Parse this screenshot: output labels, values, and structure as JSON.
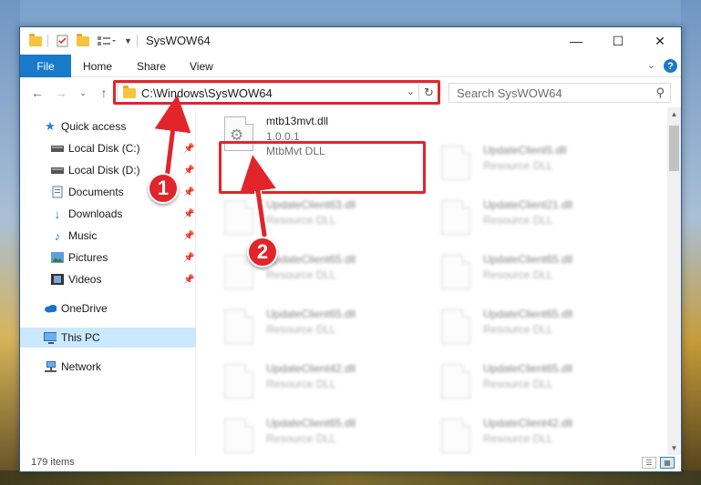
{
  "window": {
    "title": "SysWOW64",
    "controls": {
      "minimize": "—",
      "maximize": "☐",
      "close": "✕"
    }
  },
  "ribbon": {
    "tabs": [
      "File",
      "Home",
      "Share",
      "View"
    ],
    "help": "?"
  },
  "navbar": {
    "address": "C:\\Windows\\SysWOW64",
    "search_placeholder": "Search SysWOW64"
  },
  "sidebar": {
    "items": [
      {
        "label": "Quick access",
        "icon": "star-icon",
        "pinned": false
      },
      {
        "label": "Local Disk (C:)",
        "icon": "drive-icon",
        "pinned": true
      },
      {
        "label": "Local Disk (D:)",
        "icon": "drive-icon",
        "pinned": true
      },
      {
        "label": "Documents",
        "icon": "documents-icon",
        "pinned": true
      },
      {
        "label": "Downloads",
        "icon": "download-icon",
        "pinned": true
      },
      {
        "label": "Music",
        "icon": "music-icon",
        "pinned": true
      },
      {
        "label": "Pictures",
        "icon": "pictures-icon",
        "pinned": true
      },
      {
        "label": "Videos",
        "icon": "videos-icon",
        "pinned": true
      },
      {
        "label": "OneDrive",
        "icon": "cloud-icon",
        "pinned": false
      },
      {
        "label": "This PC",
        "icon": "computer-icon",
        "pinned": false,
        "selected": true
      },
      {
        "label": "Network",
        "icon": "network-icon",
        "pinned": false
      }
    ]
  },
  "files": {
    "highlighted": {
      "name": "mtb13mvt.dll",
      "version": "1.0.0.1",
      "description": "MtbMvt DLL"
    },
    "left_column": [
      {
        "name": "UpdateClient63.dll",
        "type": "Resource DLL"
      },
      {
        "name": "UpdateClient65.dll",
        "type": "Resource DLL"
      },
      {
        "name": "UpdateClient65.dll",
        "type": "Resource DLL"
      },
      {
        "name": "UpdateClient42.dll",
        "type": "Resource DLL"
      },
      {
        "name": "UpdateClient65.dll",
        "type": "Resource DLL"
      }
    ],
    "right_column": [
      {
        "name": "UpdateClient5.dll",
        "type": "Resource DLL"
      },
      {
        "name": "UpdateClient21.dll",
        "type": "Resource DLL"
      },
      {
        "name": "UpdateClient65.dll",
        "type": "Resource DLL"
      },
      {
        "name": "UpdateClient65.dll",
        "type": "Resource DLL"
      },
      {
        "name": "UpdateClient65.dll",
        "type": "Resource DLL"
      },
      {
        "name": "UpdateClient42.dll",
        "type": "Resource DLL"
      }
    ]
  },
  "status": {
    "item_count": "179 items"
  },
  "annotations": {
    "step1": "1",
    "step2": "2",
    "color": "#e2242b"
  }
}
